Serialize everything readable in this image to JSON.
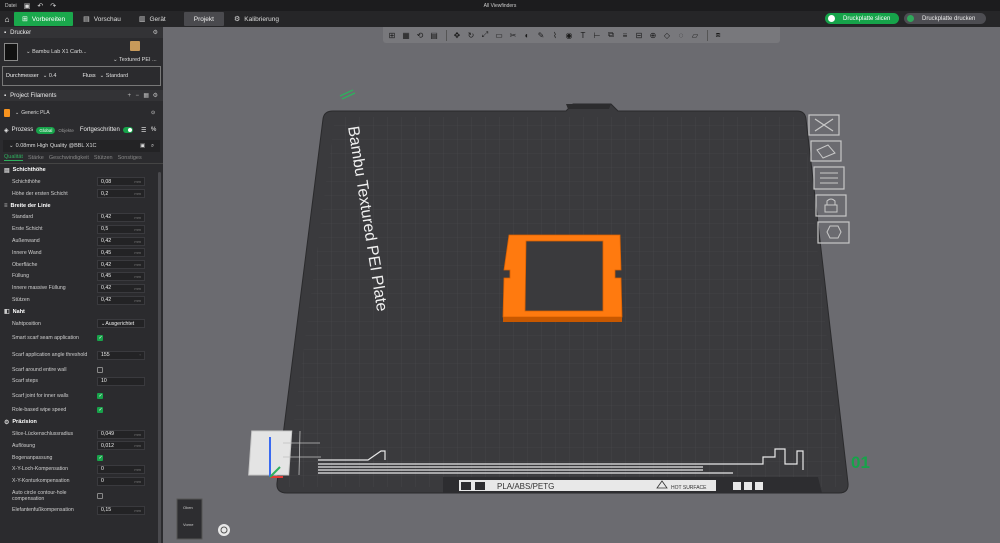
{
  "titlebar": {
    "file_label": "Datei",
    "title": "All Viewfinders"
  },
  "tabs": [
    {
      "label": "Vorbereiten",
      "icon": "prepare-icon"
    },
    {
      "label": "Vorschau",
      "icon": "preview-icon"
    },
    {
      "label": "Gerät",
      "icon": "device-icon"
    },
    {
      "label": "Projekt",
      "icon": ""
    },
    {
      "label": "Kalibrierung",
      "icon": "calibration-icon"
    }
  ],
  "actions": {
    "slice_label": "Druckplatte slicen",
    "print_label": "Druckplatte drucken"
  },
  "printer": {
    "header": "Drucker",
    "name": "Bambu Lab X1 Carb...",
    "plate": "Textured PEI ...",
    "nozzle_label": "Durchmesser",
    "nozzle_value": "0.4",
    "flow_label": "Fluss",
    "flow_value": "Standard"
  },
  "filaments": {
    "header": "Project Filaments",
    "items": [
      {
        "index": "1",
        "name": "Generic PLA",
        "color": "#f7931e"
      }
    ]
  },
  "process": {
    "label": "Prozess",
    "global": "Global",
    "objects": "Objekte",
    "advanced": "Fortgeschritten",
    "preset": "0.08mm High Quality @BBL X1C"
  },
  "subtabs": [
    "Qualität",
    "Stärke",
    "Geschwindigkeit",
    "Stützen",
    "Sonstiges"
  ],
  "sections": [
    {
      "title": "Schichthöhe",
      "rows": [
        {
          "label": "Schichthöhe",
          "type": "num",
          "value": "0,08",
          "unit": "mm"
        },
        {
          "label": "Höhe der ersten Schicht",
          "type": "num",
          "value": "0,2",
          "unit": "mm"
        }
      ]
    },
    {
      "title": "Breite der Linie",
      "rows": [
        {
          "label": "Standard",
          "type": "num",
          "value": "0,42",
          "unit": "mm"
        },
        {
          "label": "Erste Schicht",
          "type": "num",
          "value": "0,5",
          "unit": "mm"
        },
        {
          "label": "Außenwand",
          "type": "num",
          "value": "0,42",
          "unit": "mm"
        },
        {
          "label": "Innere Wand",
          "type": "num",
          "value": "0,45",
          "unit": "mm"
        },
        {
          "label": "Oberfläche",
          "type": "num",
          "value": "0,42",
          "unit": "mm"
        },
        {
          "label": "Füllung",
          "type": "num",
          "value": "0,45",
          "unit": "mm"
        },
        {
          "label": "Innere massive Füllung",
          "type": "num",
          "value": "0,42",
          "unit": "mm"
        },
        {
          "label": "Stützen",
          "type": "num",
          "value": "0,42",
          "unit": "mm"
        }
      ]
    },
    {
      "title": "Naht",
      "rows": [
        {
          "label": "Nahtposition",
          "type": "select",
          "value": "Ausgerichtet"
        },
        {
          "label": "Smart scarf seam application",
          "type": "check",
          "checked": true
        },
        {
          "label": "Scarf application angle threshold",
          "type": "num",
          "value": "155",
          "unit": "°"
        },
        {
          "label": "Scarf around entire wall",
          "type": "check",
          "checked": false
        },
        {
          "label": "Scarf steps",
          "type": "num",
          "value": "10",
          "unit": ""
        },
        {
          "label": "Scarf joint for inner walls",
          "type": "check",
          "checked": true
        },
        {
          "label": "Role-based wipe speed",
          "type": "check",
          "checked": true
        }
      ]
    },
    {
      "title": "Präzision",
      "rows": [
        {
          "label": "Slice-Lückenschlussradius",
          "type": "num",
          "value": "0,049",
          "unit": "mm"
        },
        {
          "label": "Auflösung",
          "type": "num",
          "value": "0,012",
          "unit": "mm"
        },
        {
          "label": "Bogenanpassung",
          "type": "check",
          "checked": true
        },
        {
          "label": "X-Y-Loch-Kompensation",
          "type": "num",
          "value": "0",
          "unit": "mm"
        },
        {
          "label": "X-Y-Konturkompensation",
          "type": "num",
          "value": "0",
          "unit": "mm"
        },
        {
          "label": "Auto circle contour-hole compensation",
          "type": "check",
          "checked": false
        },
        {
          "label": "Elefantenfußkompensation",
          "type": "num",
          "value": "0,15",
          "unit": "mm"
        }
      ]
    }
  ],
  "viewport": {
    "plate_text": "Bambu Textured PEI Plate",
    "plate_number": "01",
    "material_label": "PLA/ABS/PETG",
    "hot_surface": "HOT SURFACE",
    "object_color": "#ff7a0f",
    "plate_color": "#3a3a3d",
    "accent": "#17a34a",
    "viewcube_top": "Oben",
    "viewcube_front": "Vorne"
  }
}
